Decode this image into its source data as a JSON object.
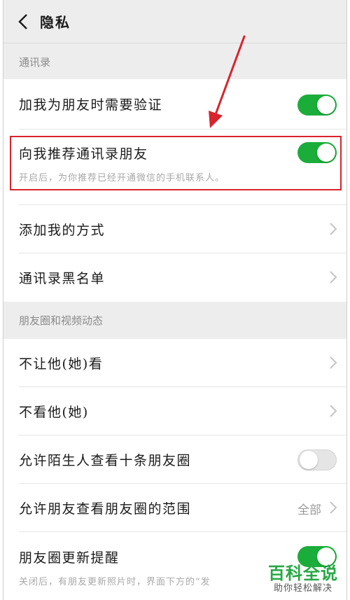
{
  "navbar": {
    "title": "隐私"
  },
  "sections": {
    "contacts_header": "通讯录",
    "moments_header": "朋友圈和视频动态"
  },
  "rows": {
    "verify_friend": {
      "label": "加我为朋友时需要验证",
      "toggle": "on"
    },
    "recommend_contacts": {
      "label": "向我推荐通讯录朋友",
      "desc": "开启后，为你推荐已经开通微信的手机联系人。",
      "toggle": "on"
    },
    "add_methods": {
      "label": "添加我的方式"
    },
    "blacklist": {
      "label": "通讯录黑名单"
    },
    "hide_my_moments": {
      "label": "不让他(她)看"
    },
    "hide_their_moments": {
      "label": "不看他(她)"
    },
    "stranger_ten_posts": {
      "label": "允许陌生人查看十条朋友圈",
      "toggle": "off"
    },
    "moments_range": {
      "label": "允许朋友查看朋友圈的范围",
      "value": "全部"
    },
    "moments_update": {
      "label": "朋友圈更新提醒",
      "desc": "关闭后，有朋友更新照片时，界面下方的“发",
      "toggle": "on"
    }
  },
  "watermark": {
    "main": "百科全说",
    "sub": "助你轻松解决"
  },
  "colors": {
    "toggle_on": "#1aad3a",
    "highlight": "#d9232d",
    "arrow": "#d9232d",
    "watermark": "#27a844"
  }
}
